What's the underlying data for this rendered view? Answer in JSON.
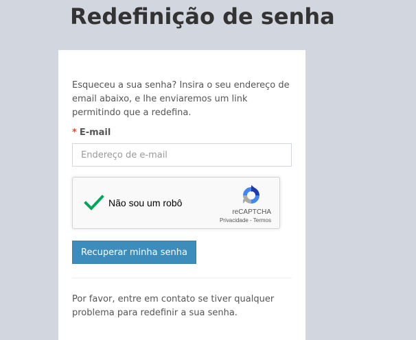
{
  "page": {
    "title": "Redefinição de senha"
  },
  "form": {
    "intro": "Esqueceu a sua senha? Insira o seu endereço de email abaixo, e lhe enviaremos um link permitindo que a redefina.",
    "required_marker": "*",
    "email_label": "E-mail",
    "email_placeholder": "Endereço de e-mail",
    "email_value": "",
    "submit_label": "Recuperar minha senha",
    "help_text": "Por favor, entre em contato se tiver qualquer problema para redefinir a sua senha."
  },
  "recaptcha": {
    "checked": true,
    "label": "Não sou um robô",
    "brand": "reCAPTCHA",
    "privacy_link": "Privacidade",
    "separator": "-",
    "terms_link": "Termos",
    "check_icon": "check-icon",
    "logo_icon": "recaptcha-logo-icon"
  },
  "colors": {
    "page_background": "#d2d6de",
    "card_background": "#ffffff",
    "primary_button": "#3c8dbc",
    "required_marker": "#dd4b39",
    "check": "#00a65a"
  }
}
